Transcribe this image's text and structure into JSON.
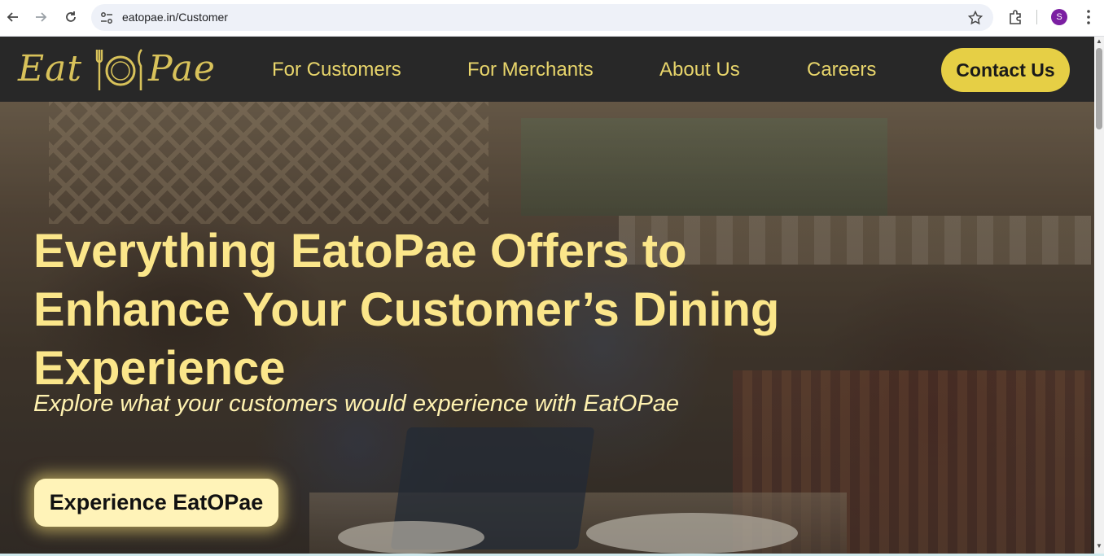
{
  "browser": {
    "url": "eatopae.in/Customer",
    "profile_initial": "S",
    "icons": [
      "back-arrow-icon",
      "forward-arrow-icon",
      "reload-icon",
      "site-settings-icon",
      "bookmark-star-icon",
      "extensions-icon",
      "more-menu-icon"
    ]
  },
  "header": {
    "logo_text_left": "Eat",
    "logo_text_right": "Pae",
    "nav": [
      {
        "label": "For Customers"
      },
      {
        "label": "For Merchants"
      },
      {
        "label": "About Us"
      },
      {
        "label": "Careers"
      }
    ],
    "contact_label": "Contact Us"
  },
  "hero": {
    "title": "Everything EatoPae Offers to Enhance Your Customer’s Dining Experience",
    "subtitle": "Explore what your customers would experience with EatOPae",
    "cta_label": "Experience EatOPae"
  },
  "colors": {
    "header_bg": "#282828",
    "accent_gold": "#e6cf45",
    "nav_text": "#e8d56b",
    "hero_title": "#fbe68a",
    "cta_bg": "#fff3b8"
  }
}
